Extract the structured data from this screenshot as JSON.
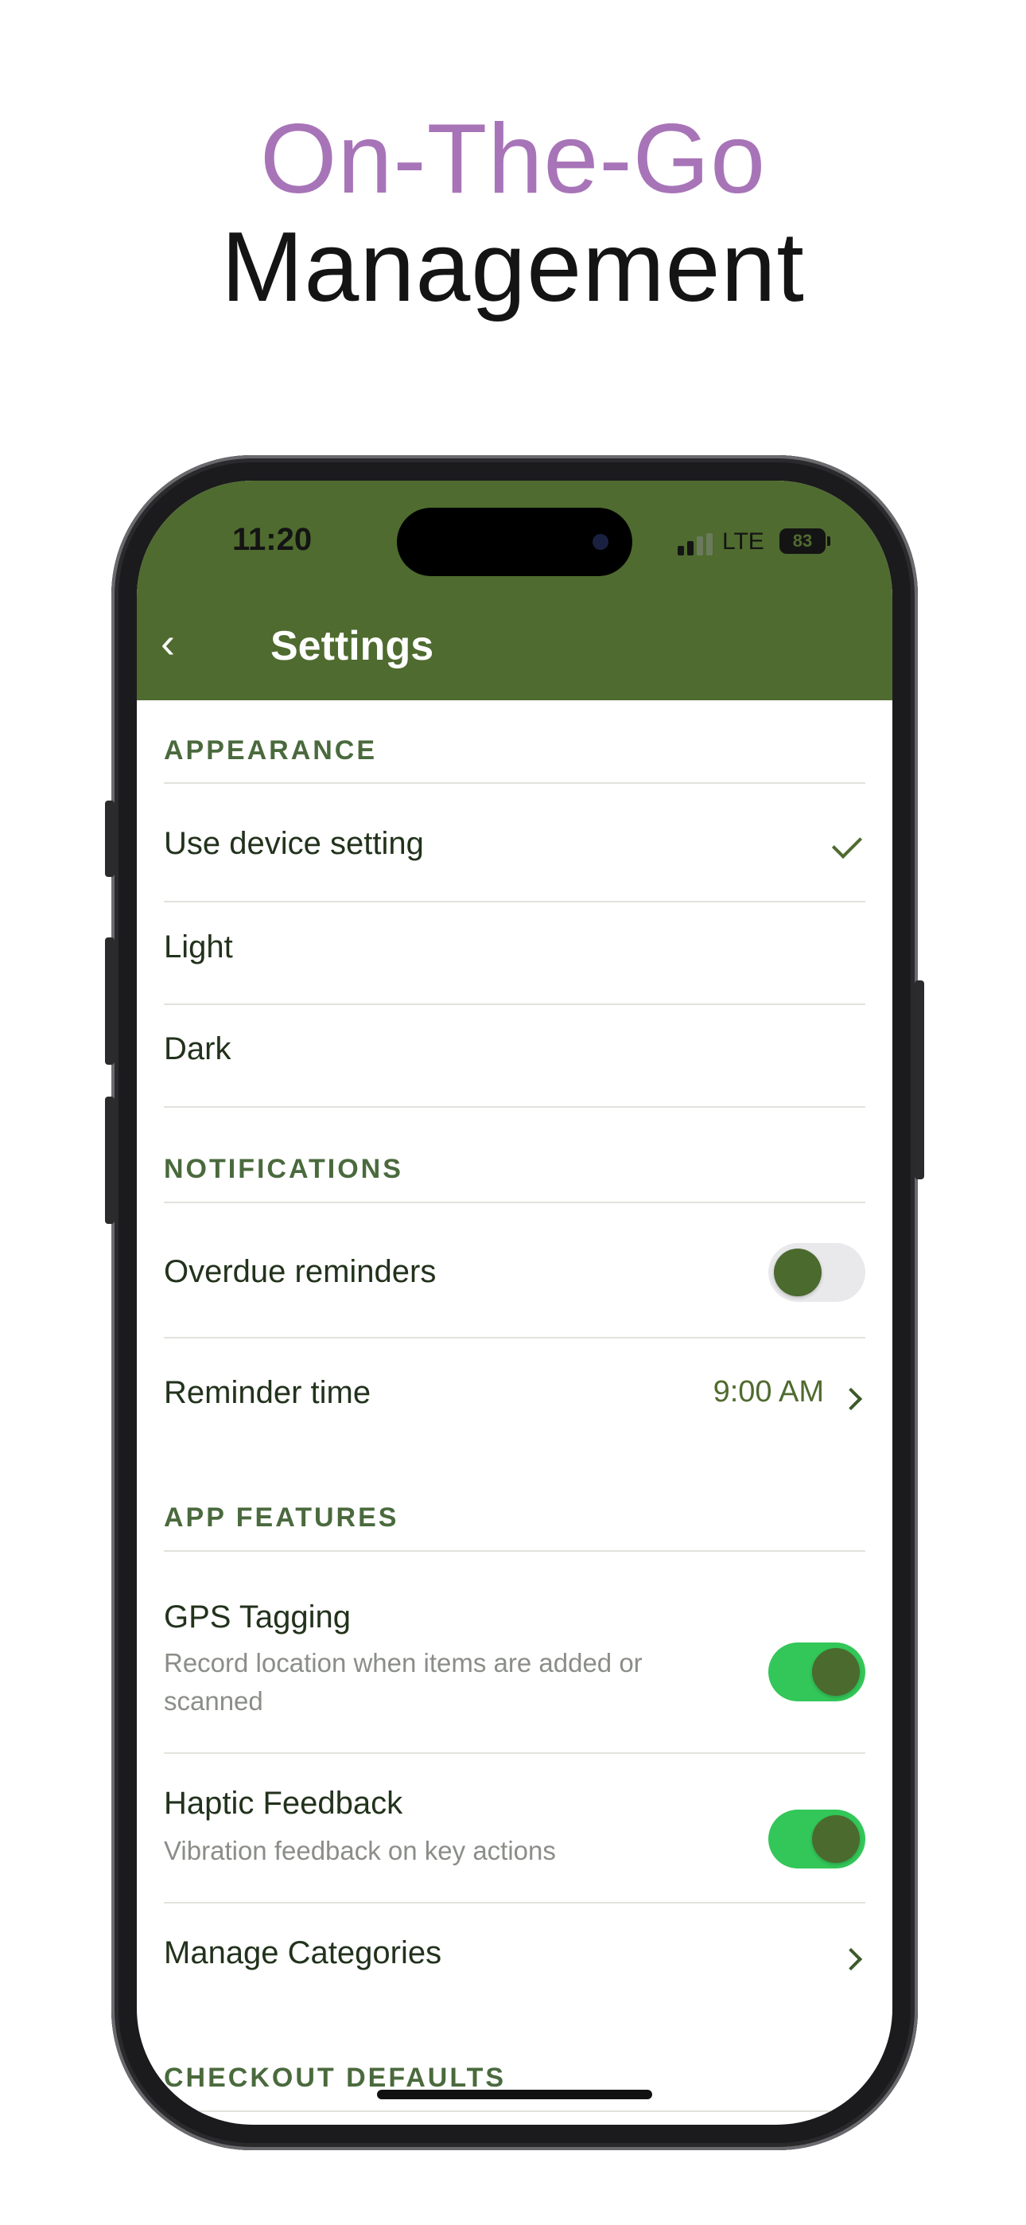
{
  "headline": {
    "line1": "On-The-Go",
    "line2": "Management"
  },
  "status_bar": {
    "time": "11:20",
    "network": "LTE",
    "battery": "83"
  },
  "nav": {
    "back_glyph": "‹",
    "title": "Settings"
  },
  "sections": {
    "appearance": {
      "title": "APPEARANCE",
      "options": [
        "Use device setting",
        "Light",
        "Dark"
      ],
      "selected": "Use device setting"
    },
    "notifications": {
      "title": "NOTIFICATIONS",
      "overdue": {
        "label": "Overdue reminders",
        "enabled": false
      },
      "reminder_time": {
        "label": "Reminder time",
        "value": "9:00 AM"
      }
    },
    "app_features": {
      "title": "APP FEATURES",
      "gps": {
        "label": "GPS Tagging",
        "description": "Record location when items are added or scanned",
        "enabled": true
      },
      "haptic": {
        "label": "Haptic Feedback",
        "description": "Vibration feedback on key actions",
        "enabled": true
      },
      "categories": {
        "label": "Manage Categories"
      }
    },
    "checkout_defaults": {
      "title": "CHECKOUT DEFAULTS"
    }
  },
  "colors": {
    "headline_accent": "#a874b8",
    "header_green": "#4f6b2f",
    "section_title": "#4a6a3d",
    "toggle_on": "#33c759"
  }
}
